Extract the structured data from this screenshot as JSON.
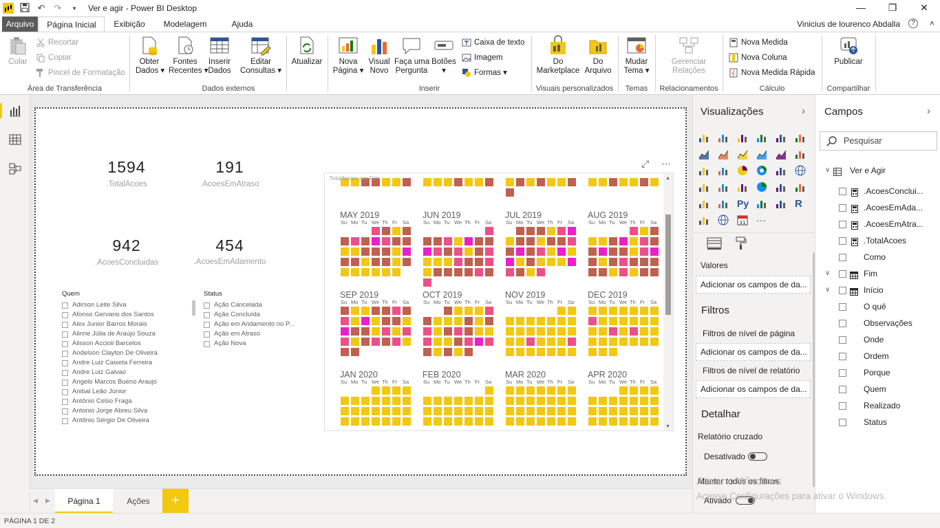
{
  "app": {
    "title": "Ver e agir - Power BI Desktop",
    "user": "Vinicius de lourenco Abdalla"
  },
  "menu": {
    "tabs": [
      "Arquivo",
      "Página Inicial",
      "Exibição",
      "Modelagem",
      "Ajuda"
    ]
  },
  "ribbon": {
    "clipboard": {
      "paste": "Colar",
      "cut": "Recortar",
      "copy": "Copiar",
      "format_painter": "Pincel de Formatação",
      "group": "Área de Transferência"
    },
    "external": {
      "get_data": [
        "Obter",
        "Dados ▾"
      ],
      "recent": [
        "Fontes",
        "Recentes ▾"
      ],
      "enter_data": [
        "Inserir",
        "Dados"
      ],
      "edit_queries": [
        "Editar",
        "Consultas ▾"
      ],
      "group": "Dados externos"
    },
    "refresh": "Atualizar",
    "insert": {
      "new_page": [
        "Nova",
        "Página ▾"
      ],
      "new_visual": [
        "Visual",
        "Novo"
      ],
      "ask": [
        "Faça uma",
        "Pergunta"
      ],
      "buttons": [
        "Botões",
        "▾"
      ],
      "textbox": "Caixa de texto",
      "image": "Imagem",
      "shapes": "Formas ▾",
      "group": "Inserir"
    },
    "custom_visuals": {
      "marketplace": [
        "Do",
        "Marketplace"
      ],
      "from_file": [
        "Do",
        "Arquivo"
      ],
      "group": "Visuais personalizados"
    },
    "themes": {
      "switch": [
        "Mudar",
        "Tema ▾"
      ],
      "group": "Temas"
    },
    "relationships": {
      "manage": [
        "Gerenciar",
        "Relações"
      ],
      "group": "Relacionamentos"
    },
    "calculations": {
      "new_measure": "Nova Medida",
      "new_column": "Nova Coluna",
      "quick_measure": "Nova Medida Rápida",
      "group": "Cálculo"
    },
    "share": {
      "publish": "Publicar",
      "group": "Compartilhar"
    }
  },
  "kpis": [
    {
      "value": "1594",
      "label": ".TotalAcoes"
    },
    {
      "value": "191",
      "label": ".AcoesEmAtraso"
    },
    {
      "value": "942",
      "label": ".AcoesConcluidas"
    },
    {
      "value": "454",
      "label": ".AcoesEmAdamento"
    }
  ],
  "slicer_quem": {
    "title": "Quem",
    "items": [
      "Adirson Leite Silva",
      "Afonso Gervano dos Santos",
      "Alex Junior Barros Morais",
      "Alinne Júlia de Araújo Souza",
      "Alisson Accioli Barcelos",
      "Andelson Clayton De Oliveira",
      "Andre Luiz Caixeta Ferreira",
      "Andre Luiz Galvao",
      "Angelo Marcos Bueno Araujo",
      "Anibal Leão Júnior",
      "Antônio Celso Fraga",
      "Antonio Jorge Abreu Silva",
      "Antônio Sérgio De Oliveira"
    ]
  },
  "slicer_status": {
    "title": "Status",
    "items": [
      "Ação Cancelada",
      "Ação Concluída",
      "Ação em Andamento no P...",
      "Ação em Atraso",
      "Ação Nova"
    ]
  },
  "chart_data": {
    "type": "heatmap",
    "title": ".TotalAcoes por Fim",
    "day_headers": [
      "Su",
      "Mo",
      "Tu",
      "We",
      "Th",
      "Fr",
      "Sa"
    ],
    "months": [
      "MAY 2019",
      "JUN 2019",
      "JUL 2019",
      "AUG 2019",
      "SEP 2019",
      "OCT 2019",
      "NOV 2019",
      "DEC 2019",
      "JAN 2020",
      "FEB 2020",
      "MAR 2020",
      "APR 2020"
    ],
    "colors": {
      "low": "#f2c811",
      "mid": "#c0604f",
      "high": "#ef4f88",
      "max": "#ee1ec8"
    }
  },
  "pages": {
    "tabs": [
      "Página 1",
      "Ações"
    ],
    "add": "+",
    "status": "PÁGINA 1 DE 2"
  },
  "viz_pane": {
    "title": "Visualizações",
    "values_label": "Valores",
    "add_fields": "Adicionar os campos de da...",
    "filters_title": "Filtros",
    "page_filters": "Filtros de nível de página",
    "report_filters": "Filtros de nível de relatório",
    "drill_title": "Detalhar",
    "cross_report": "Relatório cruzado",
    "off": "Desativado",
    "keep_filters": "Manter todos os filtros",
    "on": "Ativado"
  },
  "fields_pane": {
    "title": "Campos",
    "search_placeholder": "Pesquisar",
    "table": "Ver e Agir",
    "fields": [
      ".AcoesConclui...",
      ".AcoesEmAda...",
      ".AcoesEmAtra...",
      ".TotalAcoes",
      "Como",
      "Fim",
      "Início",
      "O quê",
      "Observações",
      "Onde",
      "Ordem",
      "Porque",
      "Quem",
      "Realizado",
      "Status"
    ]
  },
  "watermark": {
    "line1": "Ativar o Windows",
    "line2": "Acesse Configurações para ativar o Windows."
  },
  "colors": {
    "accent": "#f2c811",
    "dark_tab": "#5a5a5a"
  }
}
